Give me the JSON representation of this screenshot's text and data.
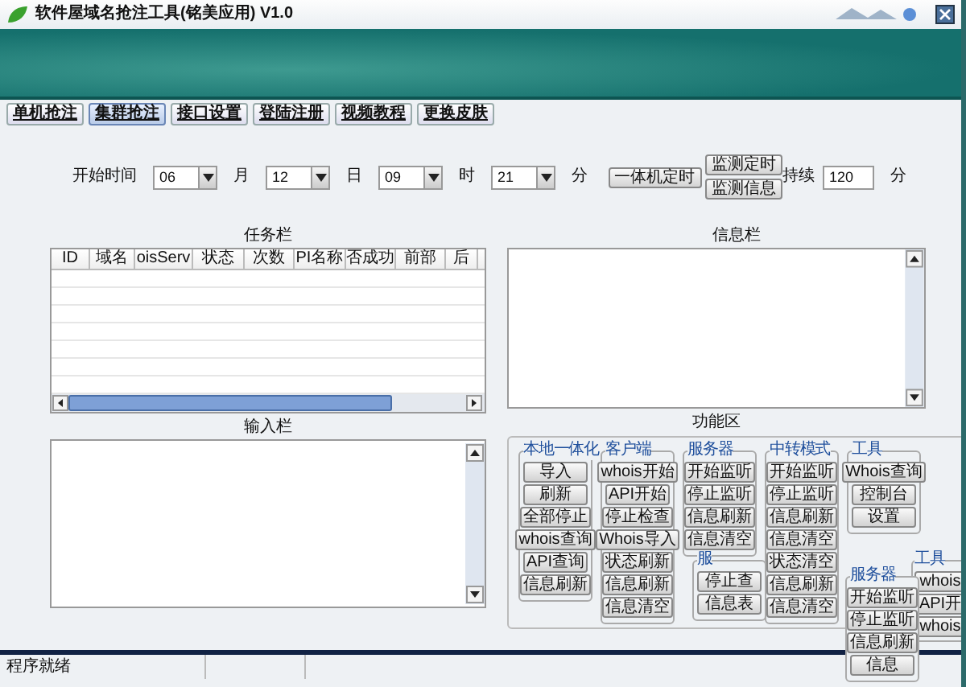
{
  "window": {
    "title": "软件屋域名抢注工具(铭美应用) V1.0"
  },
  "tabs": [
    {
      "label": "单机抢注",
      "selected": false
    },
    {
      "label": "集群抢注",
      "selected": true
    },
    {
      "label": "接口设置",
      "selected": false
    },
    {
      "label": "登陆注册",
      "selected": false
    },
    {
      "label": "视频教程",
      "selected": false
    },
    {
      "label": "更换皮肤",
      "selected": false
    }
  ],
  "schedule": {
    "start_label": "开始时间",
    "selects": [
      {
        "value": "06",
        "unit": "月"
      },
      {
        "value": "12",
        "unit": "日"
      },
      {
        "value": "09",
        "unit": "时"
      },
      {
        "value": "21",
        "unit": "分"
      }
    ],
    "timer_button": "一体机定时",
    "monitor_buttons": [
      "监测定时",
      "监测信息"
    ],
    "duration_label": "持续",
    "duration_value": "120",
    "duration_unit": "分"
  },
  "task_panel": {
    "title": "任务栏",
    "columns": [
      "ID",
      "域名",
      "oisServ",
      "状态",
      "次数",
      "PI名称",
      "否成功",
      "前部",
      "后"
    ]
  },
  "info_panel": {
    "title": "信息栏"
  },
  "input_panel": {
    "title": "输入栏"
  },
  "function_panel": {
    "title": "功能区",
    "groups": [
      {
        "title": "本地一体化",
        "buttons": [
          "导入",
          "刷新",
          "全部停止",
          "whois查询",
          "API查询",
          "信息刷新"
        ]
      },
      {
        "title": "客户端",
        "buttons": [
          "whois开始",
          "API开始",
          "停止检查",
          "Whois导入",
          "状态刷新",
          "信息刷新",
          "信息清空"
        ]
      },
      {
        "title": "服务器",
        "buttons": [
          "开始监听",
          "停止监听",
          "信息刷新",
          "信息清空"
        ]
      },
      {
        "title": "中转模式",
        "buttons": [
          "开始监听",
          "停止监听",
          "信息刷新",
          "信息清空",
          "状态清空",
          "信息刷新",
          "信息清空"
        ]
      },
      {
        "title": "工具",
        "buttons": [
          "Whois查询",
          "控制台",
          "设置"
        ]
      }
    ],
    "overlay_groups": [
      {
        "title": "服",
        "buttons": [
          "停止查",
          "信息表"
        ]
      },
      {
        "title": "服务器",
        "buttons": [
          "开始监听",
          "停止监听",
          "信息刷新",
          "信息"
        ]
      },
      {
        "title": "工具",
        "buttons": [
          "whois",
          "API开",
          "whois"
        ]
      }
    ]
  },
  "status_bar": {
    "text": "程序就绪"
  }
}
